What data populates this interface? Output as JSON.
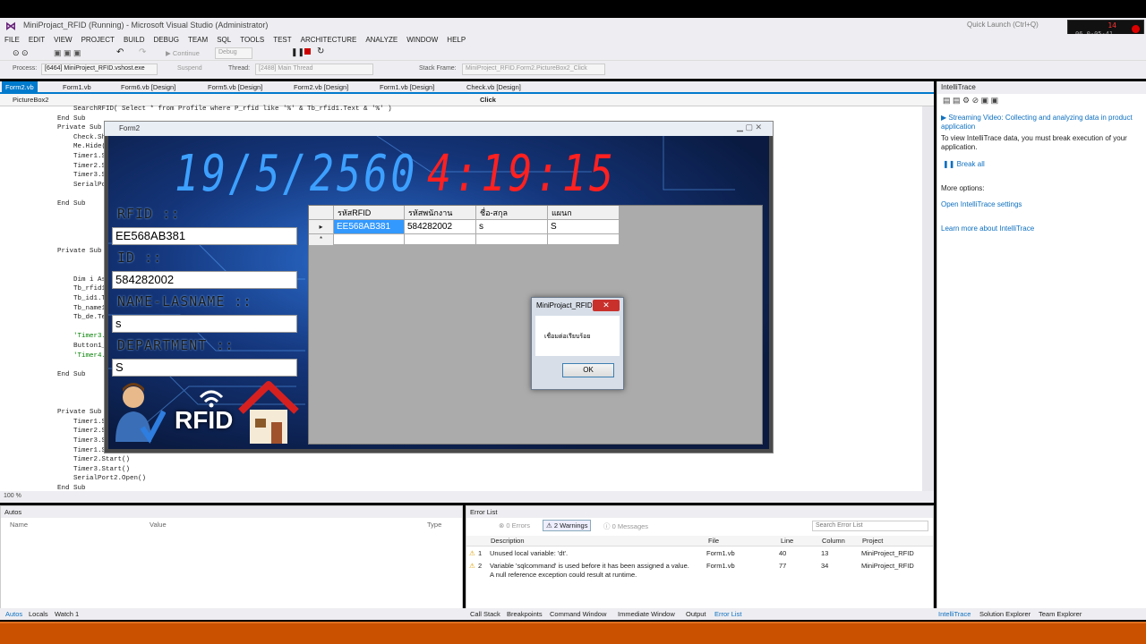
{
  "window": {
    "title": "MiniProjact_RFID (Running) - Microsoft Visual Studio (Administrator)",
    "quick_launch": "Quick Launch (Ctrl+Q)"
  },
  "menu": [
    "FILE",
    "EDIT",
    "VIEW",
    "PROJECT",
    "BUILD",
    "DEBUG",
    "TEAM",
    "SQL",
    "TOOLS",
    "TEST",
    "ARCHITECTURE",
    "ANALYZE",
    "WINDOW",
    "HELP"
  ],
  "toolbar": {
    "continue": "Continue",
    "debug": "Debug",
    "process_label": "Process:",
    "process": "[6464] MiniProject_RFID.vshost.exe",
    "suspend": "Suspend",
    "thread_label": "Thread:",
    "thread": "[2488] Main Thread",
    "stack_label": "Stack Frame:",
    "stack": "MiniProject_RFID.Form2.PictureBox2_Click"
  },
  "doc_tabs": [
    "Form2.vb",
    "Form1.vb",
    "Form6.vb [Design]",
    "Form5.vb [Design]",
    "Form2.vb [Design]",
    "Form1.vb [Design]",
    "Check.vb [Design]"
  ],
  "nav": {
    "left": "PictureBox2",
    "right": "Click"
  },
  "code": [
    "        SearchRFID( Select * from Profile where P_rfid like '%' & Tb_rfid1.Text & '%' )",
    "    End Sub",
    "    Private Sub Pi",
    "        Check.Show(",
    "        Me.Hide()",
    "        Timer1.Stop",
    "        Timer2.Stop",
    "        Timer3.Stop",
    "        SerialPort2",
    "",
    "    End Sub",
    "",
    "",
    "",
    "",
    "    Private Sub Pi",
    "",
    "",
    "        Dim i As In",
    "        Tb_rfid1.Te",
    "        Tb_id1.Text",
    "        Tb_name1.Te",
    "        Tb_de.Text",
    "",
    "        'Timer3.Sta",
    "        Button1_Cli",
    "        'Timer4.Sta",
    "",
    "    End Sub",
    "",
    "",
    "",
    "    Private Sub Pi",
    "        Timer1.Stop",
    "        Timer2.Stop",
    "        Timer3.Stop",
    "        Timer1.Star",
    "        Timer2.Start()",
    "        Timer3.Start()",
    "        SerialPort2.Open()",
    "    End Sub"
  ],
  "zoom": "100 %",
  "autos": {
    "title": "Autos",
    "cols": [
      "Name",
      "Value",
      "Type"
    ]
  },
  "errorlist": {
    "title": "Error List",
    "errors": "0 Errors",
    "warnings": "2 Warnings",
    "messages": "0 Messages",
    "search": "Search Error List",
    "cols": [
      "Description",
      "File",
      "Line",
      "Column",
      "Project"
    ],
    "rows": [
      {
        "n": "1",
        "desc": "Unused local variable: 'dt'.",
        "desc2": "",
        "file": "Form1.vb",
        "line": "40",
        "col": "13",
        "proj": "MiniProject_RFID"
      },
      {
        "n": "2",
        "desc": "Variable 'sqlcommand' is used before it has been assigned a value.",
        "desc2": "A null reference exception could result at runtime.",
        "file": "Form1.vb",
        "line": "77",
        "col": "34",
        "proj": "MiniProject_RFID"
      }
    ]
  },
  "bottom_tabs_left": [
    "Autos",
    "Locals",
    "Watch 1"
  ],
  "bottom_tabs_mid": [
    "Call Stack",
    "Breakpoints",
    "Command Window",
    "Immediate Window",
    "Output",
    "Error List"
  ],
  "bottom_tabs_right": [
    "IntelliTrace",
    "Solution Explorer",
    "Team Explorer"
  ],
  "intellitrace": {
    "title": "IntelliTrace",
    "video": "Streaming Video: Collecting and analyzing data in product",
    "video2": "application",
    "msg": "To view IntelliTrace data, you must break execution of your application.",
    "break": "Break all",
    "more": "More options:",
    "settings": "Open IntelliTrace settings",
    "learn": "Learn more about IntelliTrace"
  },
  "clock": {
    "top": "14",
    "bottom": "06   0-05-41"
  },
  "form2": {
    "title": "Form2",
    "date": "19/5/2560",
    "time": "4:19:15",
    "labels": {
      "rfid": "RFID ::",
      "id": "ID ::",
      "name": "NAME-LASNAME ::",
      "dept": "DEPARTMENT ::"
    },
    "values": {
      "rfid": "EE568AB381",
      "id": "584282002",
      "name": "s",
      "dept": "S"
    },
    "logo_text": "RFID",
    "grid": {
      "headers": [
        "รหัสRFID",
        "รหัสพนักงาน",
        "ชื่อ-สกุล",
        "แผนก"
      ],
      "rows": [
        [
          "EE568AB381",
          "584282002",
          "s",
          "S"
        ]
      ]
    }
  },
  "msgbox": {
    "title": "MiniProjact_RFID",
    "text": "เชื่อมต่อเรียบร้อย",
    "ok": "OK"
  },
  "colors": {
    "accent": "#007acc",
    "status": "#ca5100",
    "date": "#3da0ff",
    "time": "#ff2020"
  }
}
